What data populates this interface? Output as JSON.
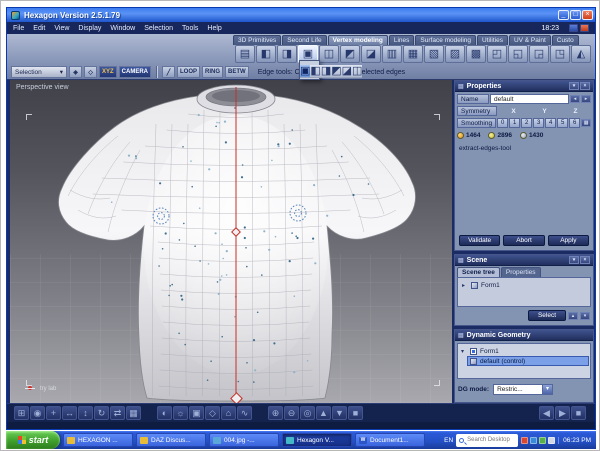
{
  "theme": {
    "titlebar_blue": "#3d7df0",
    "ribbon_gray_blue": "#8b99ba",
    "panel_bg": "#8393b2",
    "selection_blue": "#7ba0e8",
    "symmetry_line_red": "#c62f26",
    "taskbar_blue": "#2450c4",
    "start_green": "#3fa02c"
  },
  "window": {
    "title": "Hexagon Version 2.5.1.79",
    "clock": "18:23",
    "menu_items": [
      "File",
      "Edit",
      "View",
      "Display",
      "Window",
      "Selection",
      "Tools",
      "Help"
    ]
  },
  "ribbon": {
    "tabs": [
      {
        "label": "3D Primitives"
      },
      {
        "label": "Second Life"
      },
      {
        "label": "Vertex modeling",
        "active": true
      },
      {
        "label": "Lines"
      },
      {
        "label": "Surface modeling"
      },
      {
        "label": "Utilities"
      },
      {
        "label": "UV & Paint"
      },
      {
        "label": "Custo"
      }
    ],
    "tools": [
      {
        "name": "tessellate-tool-icon",
        "glyph": "▤"
      },
      {
        "name": "extrude-surface-tool-icon",
        "glyph": "◧"
      },
      {
        "name": "sweep-surface-tool-icon",
        "glyph": "◨"
      },
      {
        "name": "extract-edges-tool-icon",
        "glyph": "▣",
        "active": true
      },
      {
        "name": "bridge-tool-icon",
        "glyph": "◫"
      },
      {
        "name": "smooth-tool-icon",
        "glyph": "◩"
      },
      {
        "name": "weld-tool-icon",
        "glyph": "◪"
      },
      {
        "name": "chamfer-tool-icon",
        "glyph": "▥"
      },
      {
        "name": "dissolve-tool-icon",
        "glyph": "▦"
      },
      {
        "name": "decimate-tool-icon",
        "glyph": "▧"
      },
      {
        "name": "triangulate-tool-icon",
        "glyph": "▨"
      },
      {
        "name": "quadrangulate-tool-icon",
        "glyph": "▩"
      },
      {
        "name": "symmetry-tool-icon",
        "glyph": "◰"
      },
      {
        "name": "cut-tool-icon",
        "glyph": "◱"
      },
      {
        "name": "connect-tool-icon",
        "glyph": "◲"
      },
      {
        "name": "dislocate-tool-icon",
        "glyph": "◳"
      },
      {
        "name": "mirror-tool-icon",
        "glyph": "◭"
      }
    ]
  },
  "options_bar": {
    "selection_label": "Selection",
    "xyz_label": "XYZ",
    "camera_label": "CAMERA",
    "loop_label": "LOOP",
    "ring_label": "RING",
    "between_label": "BETW",
    "status_text": "Edge tools: Creates edges from selected edges"
  },
  "flyout": {
    "icons": [
      {
        "name": "extract-edges-variant-1-icon",
        "glyph": "▣",
        "active": true
      },
      {
        "name": "extract-edges-variant-2-icon",
        "glyph": "◧"
      },
      {
        "name": "extract-edges-variant-3-icon",
        "glyph": "◨"
      },
      {
        "name": "extract-edges-variant-4-icon",
        "glyph": "◩"
      },
      {
        "name": "extract-edges-variant-5-icon",
        "glyph": "◪"
      },
      {
        "name": "extract-edges-variant-6-icon",
        "glyph": "◫"
      }
    ]
  },
  "viewport": {
    "label": "Perspective view",
    "hint": "try lab"
  },
  "properties": {
    "title": "Properties",
    "name_label": "Name",
    "name_value": "default",
    "symmetry_label": "Symmetry",
    "axes": [
      "X",
      "Y",
      "Z"
    ],
    "smoothing_label": "Smoothing",
    "smoothing_levels": [
      "0",
      "1",
      "2",
      "3",
      "4",
      "5",
      "6"
    ],
    "counts": [
      {
        "name": "points-count",
        "value": "1464"
      },
      {
        "name": "edges-count",
        "value": "2896"
      },
      {
        "name": "faces-count",
        "value": "1430"
      }
    ],
    "tool_name": "extract-edges-tool",
    "validate_label": "Validate",
    "abort_label": "Abort",
    "apply_label": "Apply"
  },
  "scene": {
    "title": "Scene",
    "tabs": [
      {
        "label": "Scene tree",
        "active": true
      },
      {
        "label": "Properties"
      }
    ],
    "item": "Form1",
    "select_label": "Select"
  },
  "dynamic_geometry": {
    "title": "Dynamic Geometry",
    "root_item": "Form1",
    "child_item": "default (control)",
    "mode_label": "DG mode:",
    "mode_value": "Restric..."
  },
  "bottom_toolbar": {
    "group1": [
      {
        "name": "select-mode-icon",
        "glyph": "⊞"
      },
      {
        "name": "magnet-icon",
        "glyph": "◉"
      },
      {
        "name": "snap-grid-icon",
        "glyph": "+"
      },
      {
        "name": "translate-icon",
        "glyph": "↔"
      },
      {
        "name": "scale-icon",
        "glyph": "↕"
      },
      {
        "name": "rotate-icon",
        "glyph": "↻"
      },
      {
        "name": "swap-axes-icon",
        "glyph": "⇄"
      },
      {
        "name": "grid-icon",
        "glyph": "▦"
      }
    ],
    "group2": [
      {
        "name": "shading-icon",
        "glyph": "◐"
      },
      {
        "name": "light-icon",
        "glyph": "☼"
      },
      {
        "name": "material-icon",
        "glyph": "▣"
      },
      {
        "name": "wireframe-icon",
        "glyph": "◇"
      },
      {
        "name": "home-view-icon",
        "glyph": "⌂"
      },
      {
        "name": "curve-icon",
        "glyph": "∿"
      }
    ],
    "group3": [
      {
        "name": "zoom-in-icon",
        "glyph": "⊕"
      },
      {
        "name": "zoom-out-icon",
        "glyph": "⊖"
      },
      {
        "name": "orbit-icon",
        "glyph": "◎"
      },
      {
        "name": "pan-up-icon",
        "glyph": "▲"
      },
      {
        "name": "pan-down-icon",
        "glyph": "▼"
      },
      {
        "name": "full-view-icon",
        "glyph": "■"
      }
    ],
    "group4": [
      {
        "name": "prev-view-icon",
        "glyph": "◀"
      },
      {
        "name": "next-view-icon",
        "glyph": "▶"
      },
      {
        "name": "stop-icon",
        "glyph": "■"
      }
    ]
  },
  "taskbar": {
    "start_label": "start",
    "tasks": [
      {
        "label": "HEXAGON ...",
        "icon_color": "#e8bc38"
      },
      {
        "label": "DAZ Discus...",
        "icon_color": "#e8bc38"
      },
      {
        "label": "004.jpg -...",
        "icon_color": "#5aa8d8"
      },
      {
        "label": "Hexagon V...",
        "icon_color": "#45b8c8",
        "active": true
      },
      {
        "label": "Document1...",
        "icon_color": "#2a56c8",
        "icon_letter": "W"
      }
    ],
    "language": "EN",
    "search_placeholder": "Search Desktop",
    "tray_icons": [
      {
        "name": "tray-icon-red",
        "color": "#d84830"
      },
      {
        "name": "tray-icon-blue",
        "color": "#3a8ad8"
      },
      {
        "name": "tray-icon-green",
        "color": "#58b048"
      },
      {
        "name": "tray-icon-gray",
        "color": "#d0d8e8"
      }
    ],
    "clock": "06:23 PM"
  }
}
